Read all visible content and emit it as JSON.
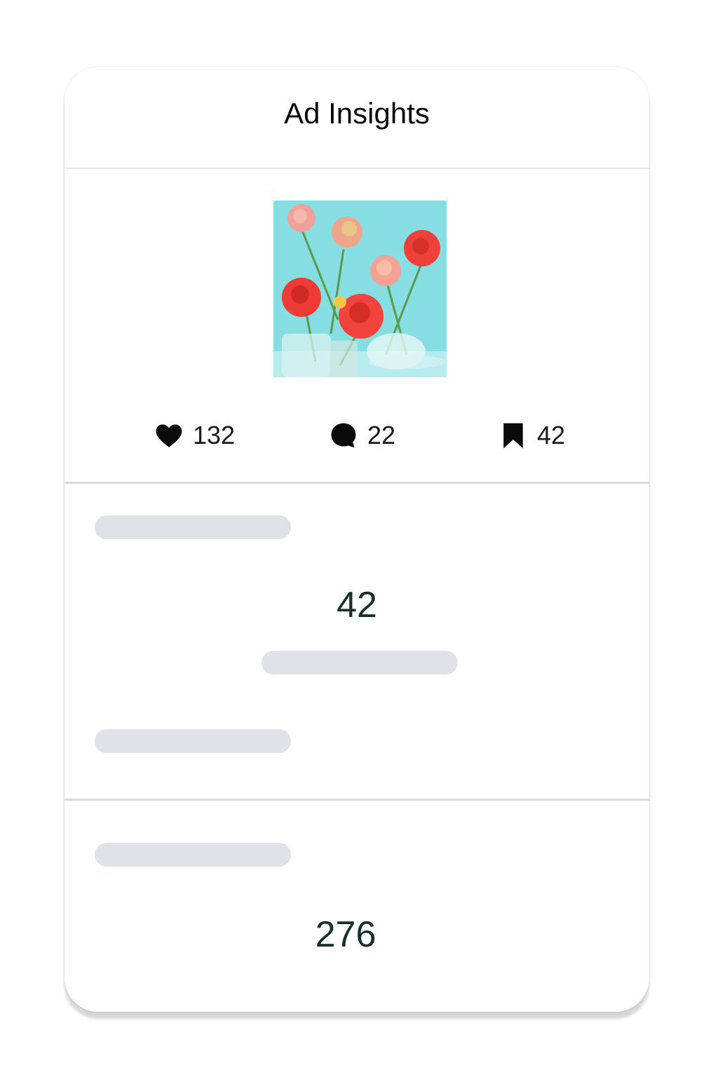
{
  "header": {
    "title": "Ad Insights"
  },
  "post": {
    "image_alt": "Pink and red ranunculus flowers in glass vases on a turquoise background",
    "likes": "132",
    "comments": "22",
    "saves": "42"
  },
  "metrics": {
    "primary_value": "42",
    "secondary_value": "276"
  },
  "colors": {
    "skeleton": "#dfe2e7",
    "value_text": "#17302d",
    "image_background": "#86dde2"
  },
  "icons": {
    "likes": "heart-icon",
    "comments": "comment-icon",
    "saves": "bookmark-icon"
  }
}
